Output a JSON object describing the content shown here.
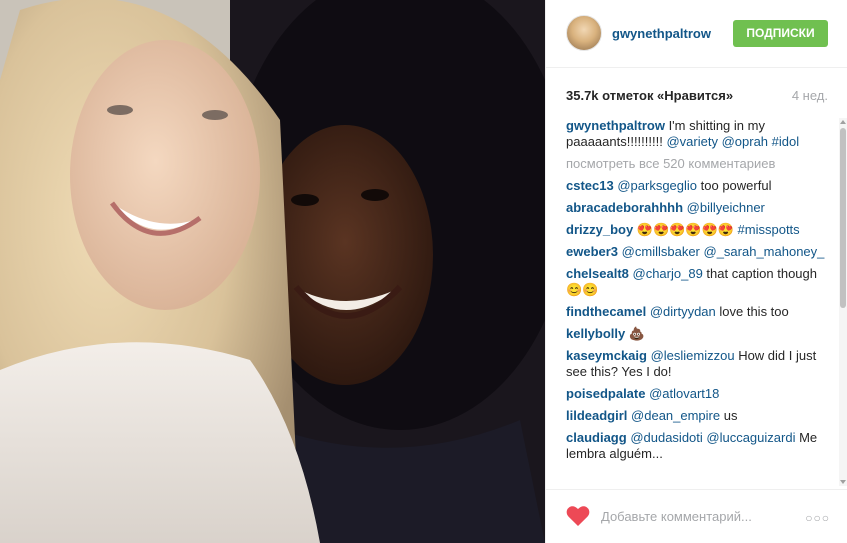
{
  "header": {
    "username": "gwynethpaltrow",
    "follow_label": "ПОДПИСКИ"
  },
  "stats": {
    "likes": "35.7k отметок «Нравится»",
    "age": "4 нед."
  },
  "caption": {
    "user": "gwynethpaltrow",
    "text": " I'm shitting in my paaaaants!!!!!!!!!! ",
    "tag1": "@variety",
    "tag2": "@oprah",
    "tag3": "#idol"
  },
  "view_all": "посмотреть все 520 комментариев",
  "comments": [
    {
      "user": "cstec13",
      "tag": "@parksgeglio",
      "text": " too powerful"
    },
    {
      "user": "abracadeborahhhh",
      "tag": "@billyeichner",
      "text": ""
    },
    {
      "user": "drizzy_boy",
      "tag": "#misspotts",
      "text": " 😍😍😍😍😍😍 "
    },
    {
      "user": "eweber3",
      "tag": "@cmillsbaker @_sarah_mahoney_",
      "text": ""
    },
    {
      "user": "chelsealt8",
      "tag": "@charjo_89",
      "text": " that caption though 😊😊"
    },
    {
      "user": "findthecamel",
      "tag": "@dirtyydan",
      "text": " love this too"
    },
    {
      "user": "kellybolly",
      "tag": "",
      "text": " 💩"
    },
    {
      "user": "kaseymckaig",
      "tag": "@lesliemizzou",
      "text": " How did I just see this? Yes I do!"
    },
    {
      "user": "poisedpalate",
      "tag": "@atlovart18",
      "text": ""
    },
    {
      "user": "lildeadgirl",
      "tag": "@dean_empire",
      "text": " us"
    },
    {
      "user": "claudiagg",
      "tag": "@dudasidoti @luccaguizardi",
      "text": " Me lembra alguém..."
    }
  ],
  "footer": {
    "placeholder": "Добавьте комментарий...",
    "more": "○○○"
  },
  "colors": {
    "link": "#125688",
    "follow": "#70c050",
    "heart": "#ed4956",
    "muted": "#a5a7aa"
  }
}
